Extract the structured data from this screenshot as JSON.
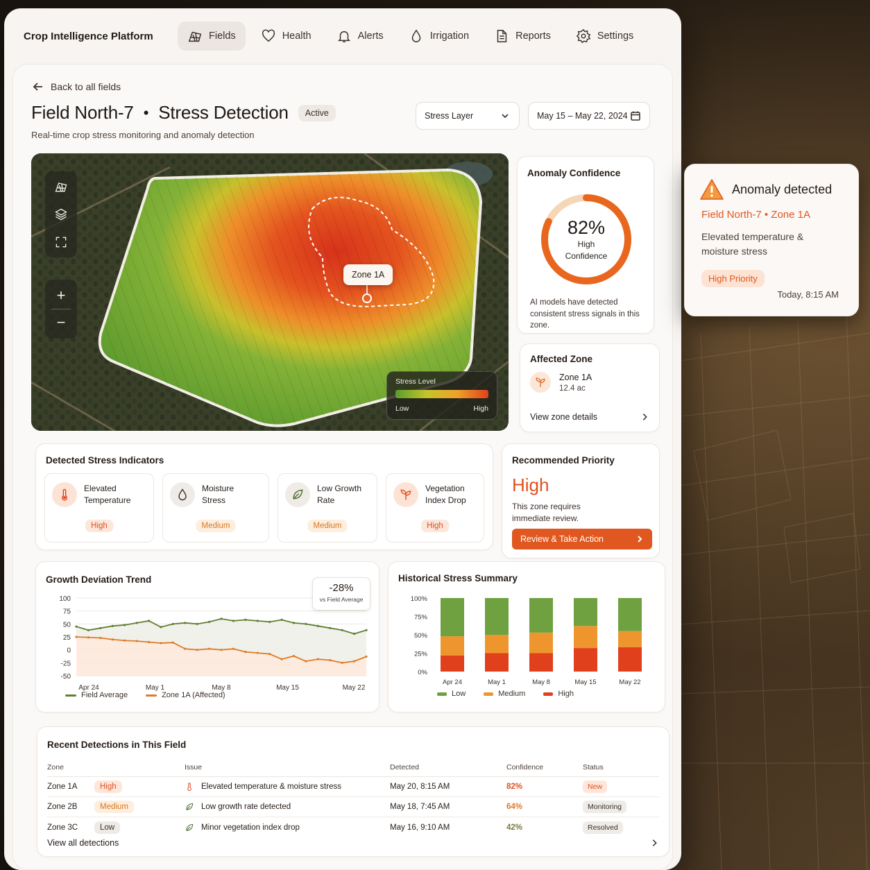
{
  "app": {
    "brand": "Crop Intelligence Platform",
    "nav": [
      {
        "label": "Fields",
        "icon": "fields-icon",
        "active": true
      },
      {
        "label": "Health",
        "icon": "heart-icon"
      },
      {
        "label": "Alerts",
        "icon": "bell-icon"
      },
      {
        "label": "Irrigation",
        "icon": "droplet-icon"
      },
      {
        "label": "Reports",
        "icon": "document-icon"
      },
      {
        "label": "Settings",
        "icon": "gear-icon"
      }
    ]
  },
  "header": {
    "back_label": "Back to all fields",
    "field_name": "Field North-7",
    "separator": "•",
    "view_name": "Stress Detection",
    "status_badge": "Active",
    "subtitle": "Real-time crop stress monitoring and anomaly detection",
    "layer_select": "Stress Layer",
    "date_range": "May 15 – May 22, 2024"
  },
  "map": {
    "zone_label": "Zone 1A",
    "legend_title": "Stress Level",
    "legend_low": "Low",
    "legend_high": "High",
    "zoom_in": "+",
    "zoom_out": "−"
  },
  "confidence": {
    "title": "Anomaly Confidence",
    "percent": "82%",
    "value": 0.82,
    "label": "High\nConfidence",
    "label_line1": "High",
    "label_line2": "Confidence",
    "note": "AI models have detected consistent stress signals in this zone."
  },
  "affected_zone": {
    "title": "Affected Zone",
    "zone": "Zone 1A",
    "area": "12.4 ac",
    "link": "View zone details"
  },
  "indicators": {
    "title": "Detected Stress Indicators",
    "items": [
      {
        "label1": "Elevated",
        "label2": "Temperature",
        "severity": "High",
        "icon": "thermometer-icon"
      },
      {
        "label1": "Moisture",
        "label2": "Stress",
        "severity": "Medium",
        "icon": "droplet-icon"
      },
      {
        "label1": "Low Growth",
        "label2": "Rate",
        "severity": "Medium",
        "icon": "leaf-icon"
      },
      {
        "label1": "Vegetation",
        "label2": "Index Drop",
        "severity": "High",
        "icon": "sprout-icon"
      }
    ]
  },
  "priority": {
    "title": "Recommended Priority",
    "level": "High",
    "note": "This zone requires immediate review.",
    "cta": "Review & Take Action"
  },
  "growth_chart": {
    "title": "Growth Deviation Trend",
    "callout_value": "-28%",
    "callout_sub": "vs Field Average"
  },
  "history_chart": {
    "title": "Historical Stress Summary"
  },
  "chart_data": [
    {
      "type": "line",
      "title": "Growth Deviation Trend",
      "x_ticks": [
        "Apr 24",
        "May 1",
        "May 8",
        "May 15",
        "May 22"
      ],
      "y_ticks": [
        100,
        75,
        50,
        25,
        0,
        -25,
        -50
      ],
      "ylim": [
        -50,
        100
      ],
      "grid": true,
      "legend_position": "bottom",
      "series": [
        {
          "name": "Field Average",
          "color": "#5f7f32",
          "values": [
            45,
            38,
            42,
            46,
            48,
            52,
            56,
            44,
            50,
            52,
            50,
            54,
            60,
            56,
            58,
            56,
            54,
            58,
            52,
            50,
            46,
            42,
            38,
            31,
            38
          ]
        },
        {
          "name": "Zone 1A (Affected)",
          "color": "#e07a26",
          "fill": true,
          "values": [
            25,
            24,
            23,
            20,
            18,
            17,
            15,
            13,
            14,
            2,
            0,
            2,
            0,
            2,
            -4,
            -6,
            -8,
            -18,
            -12,
            -22,
            -18,
            -20,
            -25,
            -22,
            -13
          ]
        }
      ],
      "callout": {
        "value": "-28%",
        "label": "vs Field Average"
      }
    },
    {
      "type": "bar",
      "stacked": true,
      "title": "Historical Stress Summary",
      "categories": [
        "Apr 24",
        "May 1",
        "May 8",
        "May 15",
        "May 22"
      ],
      "y_ticks": [
        "100%",
        "75%",
        "50%",
        "25%",
        "0%"
      ],
      "ylim": [
        0,
        100
      ],
      "legend_position": "bottom",
      "series": [
        {
          "name": "High",
          "color": "#e0401c",
          "values": [
            22,
            25,
            25,
            32,
            33
          ]
        },
        {
          "name": "Medium",
          "color": "#ee962d",
          "values": [
            26,
            25,
            28,
            30,
            22
          ]
        },
        {
          "name": "Low",
          "color": "#6fa140",
          "values": [
            52,
            50,
            47,
            38,
            45
          ]
        }
      ]
    }
  ],
  "detections": {
    "title": "Recent Detections in This Field",
    "headers": {
      "zone": "Zone",
      "issue": "Issue",
      "detected": "Detected",
      "confidence": "Confidence",
      "status": "Status"
    },
    "rows": [
      {
        "zone": "Zone 1A",
        "severity": "High",
        "issue": "Elevated temperature & moisture stress",
        "icon": "thermometer-icon",
        "detected": "May 20, 8:15 AM",
        "confidence": "82%",
        "status": "New"
      },
      {
        "zone": "Zone 2B",
        "severity": "Medium",
        "issue": "Low growth rate detected",
        "icon": "leaf-icon",
        "detected": "May 18, 7:45 AM",
        "confidence": "64%",
        "status": "Monitoring"
      },
      {
        "zone": "Zone 3C",
        "severity": "Low",
        "issue": "Minor vegetation index drop",
        "icon": "leaf-icon",
        "detected": "May 16, 9:10 AM",
        "confidence": "42%",
        "status": "Resolved"
      }
    ],
    "view_all": "View all detections"
  },
  "alert": {
    "title": "Anomaly detected",
    "location": "Field North-7 • Zone 1A",
    "description": "Elevated temperature & moisture stress",
    "priority": "High Priority",
    "time": "Today, 8:15 AM"
  },
  "colors": {
    "accent": "#e0581f",
    "high": "#e0401c",
    "medium": "#ee962d",
    "low": "#6fa140"
  }
}
